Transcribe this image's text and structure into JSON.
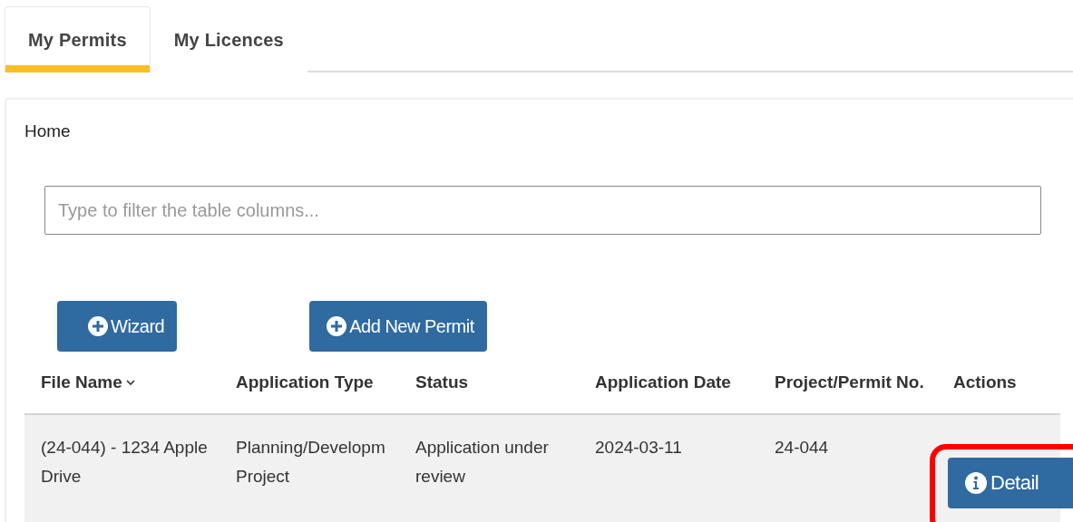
{
  "tabs": [
    {
      "label": "My Permits",
      "selected": true
    },
    {
      "label": "My Licences",
      "selected": false
    }
  ],
  "breadcrumb": "Home",
  "filter": {
    "placeholder": "Type to filter the table columns..."
  },
  "toolbar_buttons": [
    "Wizard",
    "Add New Permit"
  ],
  "table": {
    "columns": [
      {
        "label": "File Name",
        "sorted": true
      },
      {
        "label": "Application Type",
        "sorted": false
      },
      {
        "label": "Status",
        "sorted": false
      },
      {
        "label": "Application Date",
        "sorted": false
      },
      {
        "label": "Project/Permit No.",
        "sorted": false
      },
      {
        "label": "Actions",
        "sorted": false
      }
    ],
    "rows": [
      {
        "cells": [
          "(24-044) - 1234 Apple Drive",
          "Planning/Developm Project",
          "Application under review",
          "2024-03-11",
          "24-044"
        ],
        "action": "Detail",
        "highlighted": true
      }
    ]
  }
}
